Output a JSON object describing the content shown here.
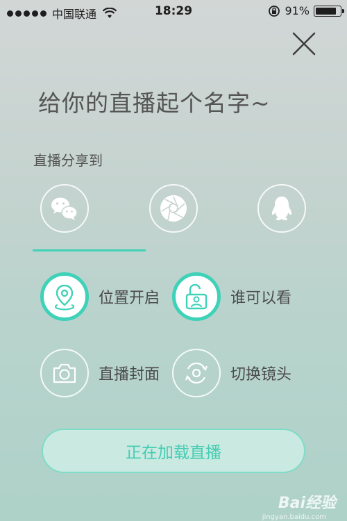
{
  "status_bar": {
    "carrier": "中国联通",
    "time": "18:29",
    "battery_percent": "91%",
    "battery_level": 0.91
  },
  "title": "给你的直播起个名字~",
  "share_label": "直播分享到",
  "share_targets": [
    {
      "icon": "wechat-icon"
    },
    {
      "icon": "moments-icon"
    },
    {
      "icon": "qq-icon"
    }
  ],
  "options": {
    "location": {
      "label": "位置开启",
      "icon": "location-pin-icon",
      "active": true
    },
    "privacy": {
      "label": "谁可以看",
      "icon": "unlock-user-icon",
      "active": true
    },
    "cover": {
      "label": "直播封面",
      "icon": "camera-icon",
      "active": false
    },
    "switch_camera": {
      "label": "切换镜头",
      "icon": "switch-camera-icon",
      "active": false
    }
  },
  "start_button": {
    "label": "正在加载直播"
  },
  "watermark": {
    "text": "Bai经验",
    "sub": "jingyan.baidu.com"
  },
  "colors": {
    "accent": "#3ed2b8",
    "button_text": "#45cdb3"
  }
}
